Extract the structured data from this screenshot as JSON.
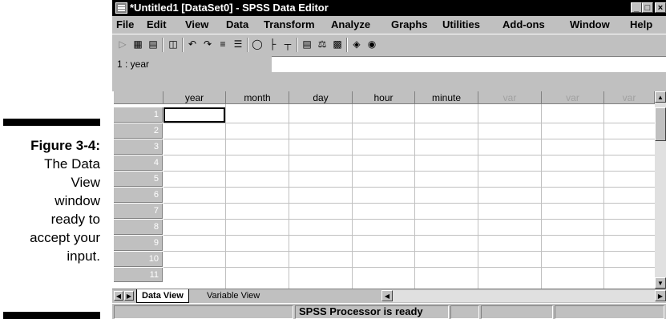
{
  "caption": {
    "figure": "Figure 3-4:",
    "lines": [
      "The Data",
      "View",
      "window",
      "ready to",
      "accept your",
      "input."
    ]
  },
  "window": {
    "title": "*Untitled1 [DataSet0] - SPSS Data Editor",
    "controls": {
      "minimize": "_",
      "restore": "□",
      "close": "×"
    }
  },
  "menu": {
    "items": [
      "File",
      "Edit",
      "View",
      "Data",
      "Transform",
      "Analyze",
      "Graphs",
      "Utilities",
      "Add-ons",
      "Window",
      "Help"
    ]
  },
  "toolbar": {
    "icons": [
      "open-icon",
      "save-icon",
      "print-icon",
      "dialog-recall-icon",
      "undo-icon",
      "redo-icon",
      "goto-case-icon",
      "variables-icon",
      "find-icon",
      "insert-cases-icon",
      "insert-variable-icon",
      "split-file-icon",
      "weight-cases-icon",
      "select-cases-icon",
      "value-labels-icon",
      "use-sets-icon"
    ]
  },
  "cell": {
    "reference": "1 : year",
    "value": ""
  },
  "grid": {
    "columns": [
      "year",
      "month",
      "day",
      "hour",
      "minute",
      "var",
      "var",
      "var"
    ],
    "rows": [
      "1",
      "2",
      "3",
      "4",
      "5",
      "6",
      "7",
      "8",
      "9",
      "10",
      "11"
    ]
  },
  "tabs": {
    "data_view": "Data View",
    "variable_view": "Variable View"
  },
  "status": {
    "processor": "SPSS Processor is ready"
  },
  "colors": {
    "chrome": "#c0c0c0",
    "titlebar": "#000000",
    "grid_line": "#c0c0c0",
    "var_header": "#a0a0a0"
  }
}
